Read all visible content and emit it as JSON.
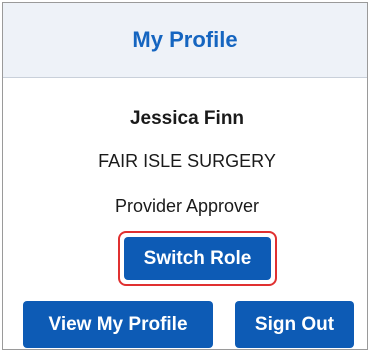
{
  "profile_panel": {
    "title": "My Profile",
    "user_name": "Jessica Finn",
    "organization": "FAIR ISLE SURGERY",
    "role": "Provider Approver",
    "buttons": {
      "switch_role": "Switch Role",
      "view_profile": "View My Profile",
      "sign_out": "Sign Out"
    }
  },
  "colors": {
    "title": "#1565c0",
    "button_bg": "#0d5bb5",
    "highlight": "#e03030",
    "header_bg": "#eef2f8"
  }
}
